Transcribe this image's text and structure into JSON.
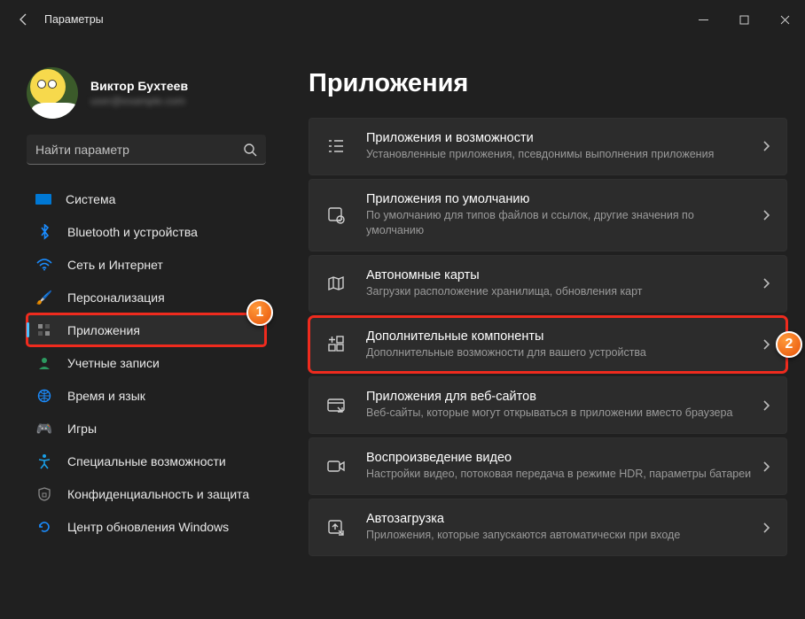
{
  "window": {
    "title": "Параметры"
  },
  "profile": {
    "name": "Виктор Бухтеев",
    "email": "user@example.com"
  },
  "search": {
    "placeholder": "Найти параметр"
  },
  "nav": {
    "items": [
      {
        "label": "Система",
        "icon": "🖥️",
        "active": false
      },
      {
        "label": "Bluetooth и устройства",
        "icon": "bt",
        "active": false
      },
      {
        "label": "Сеть и Интернет",
        "icon": "wifi",
        "active": false
      },
      {
        "label": "Персонализация",
        "icon": "🖌️",
        "active": false
      },
      {
        "label": "Приложения",
        "icon": "apps",
        "active": true
      },
      {
        "label": "Учетные записи",
        "icon": "👤",
        "active": false
      },
      {
        "label": "Время и язык",
        "icon": "🌐",
        "active": false
      },
      {
        "label": "Игры",
        "icon": "🎮",
        "active": false
      },
      {
        "label": "Специальные возможности",
        "icon": "acc",
        "active": false
      },
      {
        "label": "Конфиденциальность и защита",
        "icon": "🔒",
        "active": false
      },
      {
        "label": "Центр обновления Windows",
        "icon": "🔄",
        "active": false
      }
    ]
  },
  "main": {
    "heading": "Приложения",
    "cards": [
      {
        "title": "Приложения и возможности",
        "sub": "Установленные приложения, псевдонимы выполнения приложения"
      },
      {
        "title": "Приложения по умолчанию",
        "sub": "По умолчанию для типов файлов и ссылок, другие значения по умолчанию"
      },
      {
        "title": "Автономные карты",
        "sub": "Загрузки расположение хранилища, обновления карт"
      },
      {
        "title": "Дополнительные компоненты",
        "sub": "Дополнительные возможности для вашего устройства"
      },
      {
        "title": "Приложения для веб-сайтов",
        "sub": "Веб-сайты, которые могут открываться в приложении вместо браузера"
      },
      {
        "title": "Воспроизведение видео",
        "sub": "Настройки видео, потоковая передача в режиме HDR, параметры батареи"
      },
      {
        "title": "Автозагрузка",
        "sub": "Приложения, которые запускаются автоматически при входе"
      }
    ]
  },
  "annotations": {
    "badge1": "1",
    "badge2": "2"
  }
}
